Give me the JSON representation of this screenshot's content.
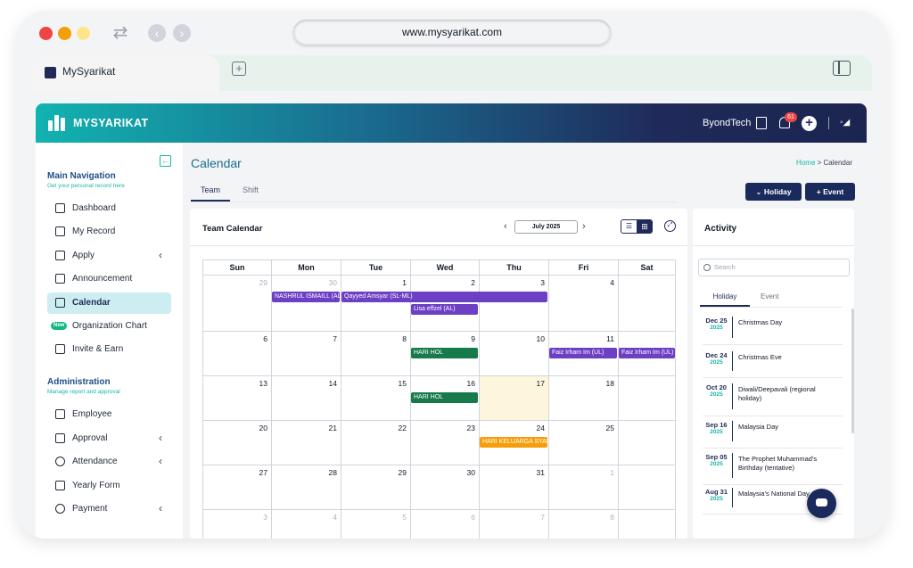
{
  "browser": {
    "url": "www.mysyarikat.com",
    "tab_label": "MySyarikat"
  },
  "topbar": {
    "brand": "MYSYARIKAT",
    "company": "ByondTech",
    "notification_count": "61"
  },
  "sidebar": {
    "main_title": "Main Navigation",
    "main_subtitle": "Get your personal record here",
    "main_items": [
      {
        "label": "Dashboard"
      },
      {
        "label": "My Record"
      },
      {
        "label": "Apply"
      },
      {
        "label": "Announcement"
      },
      {
        "label": "Calendar"
      },
      {
        "label": "Organization Chart",
        "badge": "New"
      },
      {
        "label": "Invite & Earn"
      }
    ],
    "admin_title": "Administration",
    "admin_subtitle": "Manage report and approval",
    "admin_items": [
      {
        "label": "Employee"
      },
      {
        "label": "Approval"
      },
      {
        "label": "Attendance"
      },
      {
        "label": "Yearly Form"
      },
      {
        "label": "Payment"
      }
    ]
  },
  "main": {
    "title": "Calendar",
    "breadcrumb_home": "Home",
    "breadcrumb_sep": ">",
    "breadcrumb_current": "Calendar",
    "tabs": [
      "Team",
      "Shift"
    ],
    "holiday_button": "Holiday",
    "event_button": "Event"
  },
  "calendar": {
    "title": "Team Calendar",
    "month": "July 2025",
    "weekdays": [
      "Sun",
      "Mon",
      "Tue",
      "Wed",
      "Thu",
      "Fri",
      "Sat"
    ],
    "weeks": [
      [
        {
          "d": "29",
          "m": true
        },
        {
          "d": "30",
          "m": true
        },
        {
          "d": "1"
        },
        {
          "d": "2"
        },
        {
          "d": "3"
        },
        {
          "d": "4"
        },
        {
          "d": ""
        }
      ],
      [
        {
          "d": "6"
        },
        {
          "d": "7"
        },
        {
          "d": "8"
        },
        {
          "d": "9"
        },
        {
          "d": "10"
        },
        {
          "d": "11"
        },
        {
          "d": ""
        }
      ],
      [
        {
          "d": "13"
        },
        {
          "d": "14"
        },
        {
          "d": "15"
        },
        {
          "d": "16"
        },
        {
          "d": "17",
          "today": true
        },
        {
          "d": "18"
        },
        {
          "d": ""
        }
      ],
      [
        {
          "d": "20"
        },
        {
          "d": "21"
        },
        {
          "d": "22"
        },
        {
          "d": "23"
        },
        {
          "d": "24"
        },
        {
          "d": "25"
        },
        {
          "d": ""
        }
      ],
      [
        {
          "d": "27"
        },
        {
          "d": "28"
        },
        {
          "d": "29"
        },
        {
          "d": "30"
        },
        {
          "d": "31"
        },
        {
          "d": "1",
          "m": true
        },
        {
          "d": ""
        }
      ],
      [
        {
          "d": "3",
          "m": true
        },
        {
          "d": "4",
          "m": true
        },
        {
          "d": "5",
          "m": true
        },
        {
          "d": "6",
          "m": true
        },
        {
          "d": "7",
          "m": true
        },
        {
          "d": "8",
          "m": true
        },
        {
          "d": ""
        }
      ]
    ],
    "events": [
      {
        "label": "NASHRUL ISMAILL (AL)",
        "week": 0,
        "start": 1,
        "span": 1,
        "lane": 0,
        "color": "#6d3fc4"
      },
      {
        "label": "Qayyed Amsyar (SL-ML)",
        "week": 0,
        "start": 2,
        "span": 3,
        "lane": 0,
        "color": "#6d3fc4"
      },
      {
        "label": "Lisa effzel (AL)",
        "week": 0,
        "start": 3,
        "span": 1,
        "lane": 1,
        "color": "#6d3fc4"
      },
      {
        "label": "HARI HOL",
        "week": 1,
        "start": 3,
        "span": 1,
        "lane": 0,
        "color": "#167a4a"
      },
      {
        "label": "Faiz Irham Im (UL)",
        "week": 1,
        "start": 5,
        "span": 1,
        "lane": 0,
        "color": "#6d3fc4"
      },
      {
        "label": "Faiz Irham Im (UL)",
        "week": 1,
        "start": 6,
        "span": 1,
        "lane": 0,
        "color": "#6d3fc4"
      },
      {
        "label": "HARI HOL",
        "week": 2,
        "start": 3,
        "span": 1,
        "lane": 0,
        "color": "#167a4a"
      },
      {
        "label": "HARI KELUARGA SYARIKAT",
        "week": 3,
        "start": 4,
        "span": 1,
        "lane": 0,
        "color": "#f59e0b"
      }
    ]
  },
  "activity": {
    "title": "Activity",
    "search_placeholder": "Search",
    "tabs": [
      "Holiday",
      "Event"
    ],
    "holidays": [
      {
        "date": "Dec 25",
        "year": "2025",
        "name": "Christmas Day"
      },
      {
        "date": "Dec 24",
        "year": "2025",
        "name": "Christmas Eve"
      },
      {
        "date": "Oct 20",
        "year": "2025",
        "name": "Diwali/Deepavali (regional holiday)"
      },
      {
        "date": "Sep 16",
        "year": "2025",
        "name": "Malaysia Day"
      },
      {
        "date": "Sep 05",
        "year": "2025",
        "name": "The Prophet Muhammad's Birthday (tentative)"
      },
      {
        "date": "Aug 31",
        "year": "2025",
        "name": "Malaysia's National Day"
      }
    ]
  }
}
